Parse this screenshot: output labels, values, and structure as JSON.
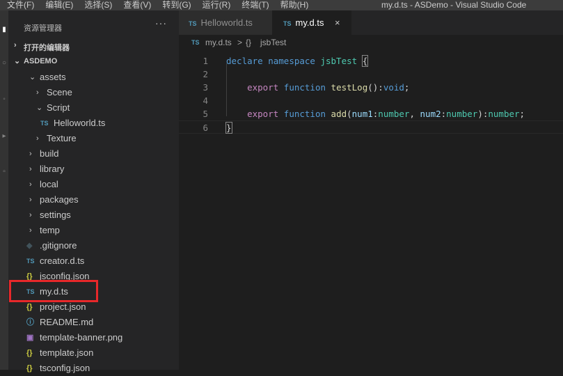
{
  "menu": [
    "文件(F)",
    "编辑(E)",
    "选择(S)",
    "查看(V)",
    "转到(G)",
    "运行(R)",
    "终端(T)",
    "帮助(H)"
  ],
  "window_title": "my.d.ts - ASDemo - Visual Studio Code",
  "sidebar": {
    "header": "资源管理器",
    "more": "···",
    "open_editors": "打开的编辑器",
    "project": "ASDEMO",
    "tree": [
      {
        "label": "assets",
        "kind": "folder-open",
        "depth": 1
      },
      {
        "label": "Scene",
        "kind": "folder",
        "depth": 2
      },
      {
        "label": "Script",
        "kind": "folder-open",
        "depth": 2
      },
      {
        "label": "Helloworld.ts",
        "kind": "ts",
        "depth": 3
      },
      {
        "label": "Texture",
        "kind": "folder",
        "depth": 2
      },
      {
        "label": "build",
        "kind": "folder",
        "depth": 1
      },
      {
        "label": "library",
        "kind": "folder",
        "depth": 1
      },
      {
        "label": "local",
        "kind": "folder",
        "depth": 1
      },
      {
        "label": "packages",
        "kind": "folder",
        "depth": 1
      },
      {
        "label": "settings",
        "kind": "folder",
        "depth": 1
      },
      {
        "label": "temp",
        "kind": "folder",
        "depth": 1
      },
      {
        "label": ".gitignore",
        "kind": "git",
        "depth": 1
      },
      {
        "label": "creator.d.ts",
        "kind": "ts",
        "depth": 1
      },
      {
        "label": "jsconfig.json",
        "kind": "json",
        "depth": 1
      },
      {
        "label": "my.d.ts",
        "kind": "ts",
        "depth": 1
      },
      {
        "label": "project.json",
        "kind": "json",
        "depth": 1
      },
      {
        "label": "README.md",
        "kind": "info",
        "depth": 1
      },
      {
        "label": "template-banner.png",
        "kind": "img",
        "depth": 1
      },
      {
        "label": "template.json",
        "kind": "json",
        "depth": 1
      },
      {
        "label": "tsconfig.json",
        "kind": "json",
        "depth": 1
      }
    ]
  },
  "tabs": [
    {
      "label": "Helloworld.ts",
      "icon": "TS",
      "active": false
    },
    {
      "label": "my.d.ts",
      "icon": "TS",
      "active": true,
      "close": "×"
    }
  ],
  "breadcrumb": {
    "icon": "TS",
    "file": "my.d.ts",
    "separator": ">",
    "symbol_icon": "{}",
    "symbol": "jsbTest"
  },
  "code_lines": [
    "1",
    "2",
    "3",
    "4",
    "5",
    "6"
  ],
  "code": {
    "l1": {
      "kw1": "declare",
      "kw2": "namespace",
      "name": "jsbTest",
      "brace": "{"
    },
    "l3": {
      "kw1": "export",
      "kw2": "function",
      "fn": "testLog",
      "rest": "():",
      "type": "void",
      "end": ";"
    },
    "l5": {
      "kw1": "export",
      "kw2": "function",
      "fn": "add",
      "p1": "num1",
      "t1": "number",
      "p2": "num2",
      "t2": "number",
      "ret": "number"
    },
    "l6": {
      "brace": "}"
    }
  },
  "icons": {
    "ts": "TS",
    "json": "{}",
    "git": "◆",
    "info": "ⓘ",
    "img": "▣",
    "chevron_right": "›",
    "chevron_down": "⌄"
  }
}
